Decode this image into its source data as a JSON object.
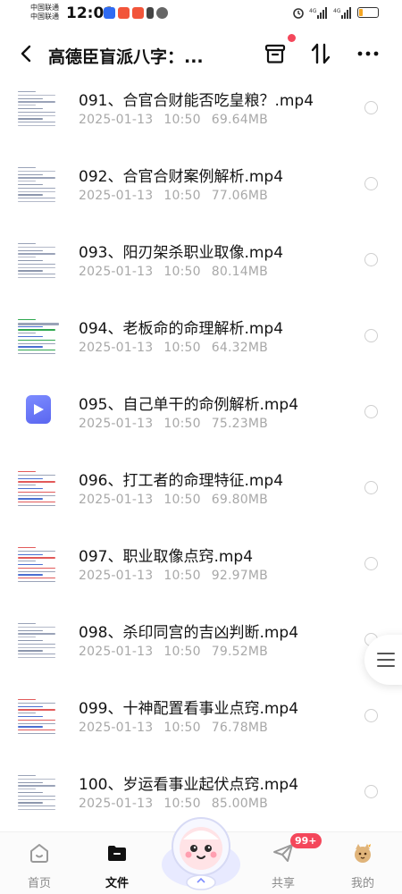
{
  "status_bar": {
    "carrier_1": "中国联通",
    "carrier_2": "中国联通",
    "time": "12:01",
    "battery_level": 0.22
  },
  "header": {
    "title": "高德臣盲派八字：...",
    "back_icon": "chevron-left-icon",
    "archive_icon": "archive-box-icon",
    "sort_icon": "sort-arrows-icon",
    "more_icon": "more-dots-icon"
  },
  "files": [
    {
      "name": "091、合官合财能否吃皇粮？.mp4",
      "date": "2025-01-13",
      "time": "10:50",
      "size": "69.64MB",
      "thumb": "document"
    },
    {
      "name": "092、合官合财案例解析.mp4",
      "date": "2025-01-13",
      "time": "10:50",
      "size": "77.06MB",
      "thumb": "document"
    },
    {
      "name": "093、阳刃架杀职业取像.mp4",
      "date": "2025-01-13",
      "time": "10:50",
      "size": "80.14MB",
      "thumb": "document"
    },
    {
      "name": "094、老板命的命理解析.mp4",
      "date": "2025-01-13",
      "time": "10:50",
      "size": "64.32MB",
      "thumb": "document-green"
    },
    {
      "name": "095、自己单干的命例解析.mp4",
      "date": "2025-01-13",
      "time": "10:50",
      "size": "75.23MB",
      "thumb": "video-icon"
    },
    {
      "name": "096、打工者的命理特征.mp4",
      "date": "2025-01-13",
      "time": "10:50",
      "size": "69.80MB",
      "thumb": "document-red"
    },
    {
      "name": "097、职业取像点窍.mp4",
      "date": "2025-01-13",
      "time": "10:50",
      "size": "92.97MB",
      "thumb": "document-red"
    },
    {
      "name": "098、杀印同宫的吉凶判断.mp4",
      "date": "2025-01-13",
      "time": "10:50",
      "size": "79.52MB",
      "thumb": "document"
    },
    {
      "name": "099、十神配置看事业点窍.mp4",
      "date": "2025-01-13",
      "time": "10:50",
      "size": "76.78MB",
      "thumb": "document-red"
    },
    {
      "name": "100、岁运看事业起伏点窍.mp4",
      "date": "2025-01-13",
      "time": "10:50",
      "size": "85.00MB",
      "thumb": "document"
    }
  ],
  "bottom_nav": {
    "home": "首页",
    "files": "文件",
    "share": "共享",
    "mine": "我的",
    "share_badge": "99+"
  },
  "colors": {
    "accent_red": "#f4475b",
    "video_thumb": "#6b78f5",
    "meta_gray": "#a8a8a8"
  }
}
